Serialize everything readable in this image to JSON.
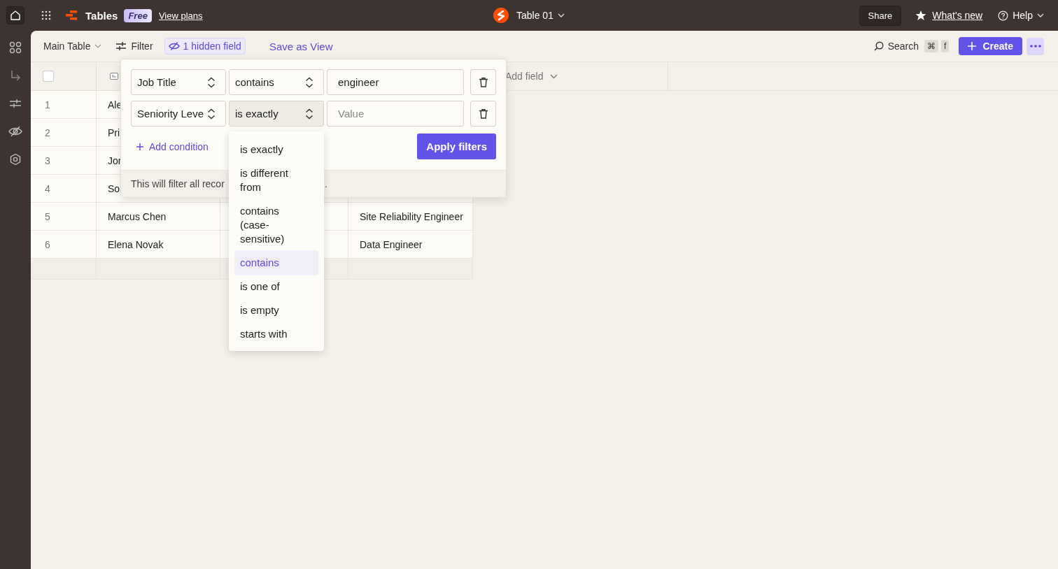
{
  "topbar": {
    "app_name": "Tables",
    "plan_badge": "Free",
    "plans_link": "View plans",
    "table_name": "Table 01",
    "share": "Share",
    "whats_new": "What's new",
    "help": "Help"
  },
  "toolbar": {
    "view": "Main Table",
    "filter": "Filter",
    "hidden_fields": "1 hidden field",
    "save_view": "Save as View",
    "search": "Search",
    "shortcut_keys": [
      "⌘",
      "f"
    ],
    "create": "Create"
  },
  "table": {
    "select_all": {
      "checked": false
    },
    "add_field": "Add field",
    "rows": [
      {
        "number": "1",
        "name": "Ale"
      },
      {
        "number": "2",
        "name": "Pri"
      },
      {
        "number": "3",
        "name": "Jor"
      },
      {
        "number": "4",
        "name": "So"
      },
      {
        "number": "5",
        "name": "Marcus Chen",
        "job_title": "Site Reliability Engineer"
      },
      {
        "number": "6",
        "name": "Elena Novak",
        "job_title": "Data Engineer"
      }
    ]
  },
  "filter_popover": {
    "conditions": [
      {
        "field": "Job Title",
        "operator": "contains",
        "value": "engineer",
        "open": false
      },
      {
        "field": "Seniority Leve",
        "operator": "is exactly",
        "placeholder": "Value",
        "open": true,
        "options": [
          {
            "label": "is exactly",
            "selected": false
          },
          {
            "label": "is different from",
            "selected": false
          },
          {
            "label": "contains (case-sensitive)",
            "selected": false
          },
          {
            "label": "contains",
            "selected": true
          },
          {
            "label": "is one of",
            "selected": false
          },
          {
            "label": "is empty",
            "selected": false
          },
          {
            "label": "starts with",
            "selected": false
          }
        ]
      }
    ],
    "add_condition": "Add condition",
    "apply": "Apply filters",
    "note": "This will filter all recor",
    "note_end": "."
  }
}
